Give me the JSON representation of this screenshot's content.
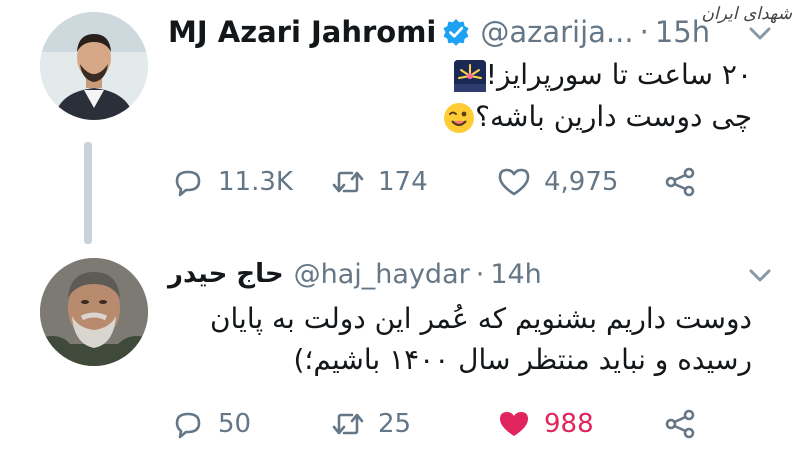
{
  "watermark": "شهدای ایران",
  "tweets": [
    {
      "name": "MJ Azari Jahromi",
      "handle": "@azarija...",
      "time": "15h",
      "lines": [
        "۲۰ ساعت تا سورپرایز!",
        "چی دوست دارین باشه؟"
      ],
      "emojis": [
        "fireworks-emoji",
        "winking-face-emoji"
      ],
      "replies": "11.3K",
      "retweets": "174",
      "likes": "4,975",
      "liked": false,
      "verified": true
    },
    {
      "name": "حاج حیدر",
      "handle": "@haj_haydar",
      "time": "14h",
      "lines": [
        "دوست داریم بشنویم که عُمر این دولت به پایان",
        "رسیده و نباید منتظر سال ۱۴۰۰ باشیم؛)"
      ],
      "replies": "50",
      "retweets": "25",
      "likes": "988",
      "liked": true,
      "verified": false
    }
  ],
  "icons": {
    "verified": "verified-badge-icon",
    "caret": "chevron-down-icon",
    "reply": "reply-icon",
    "retweet": "retweet-icon",
    "like": "heart-icon",
    "share": "share-icon"
  },
  "colors": {
    "accent": "#1da1f2",
    "secondary_text": "#657786",
    "like_active": "#e0245e",
    "thread_line": "#c9d3d9"
  }
}
